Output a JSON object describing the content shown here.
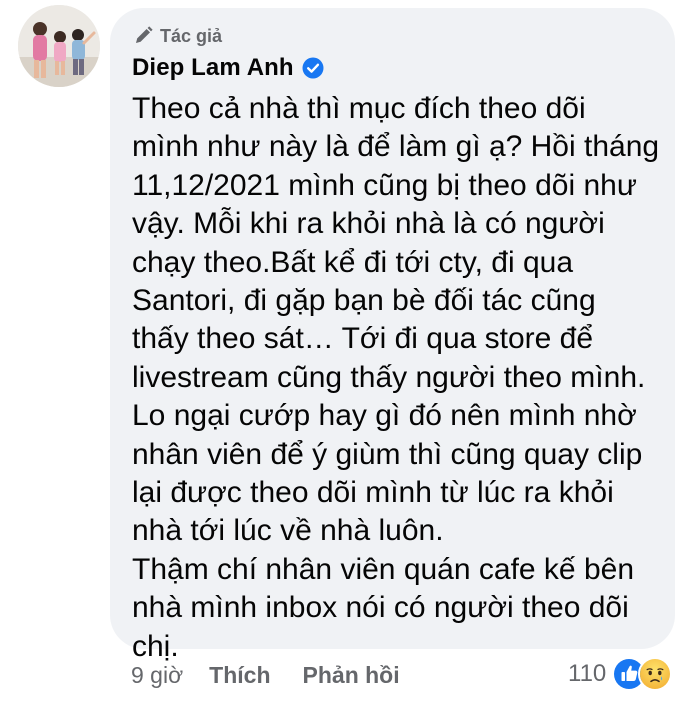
{
  "comment": {
    "author_badge": "Tác giả",
    "author_name": "Diep Lam Anh",
    "lines": [
      "Theo cả nhà thì mục đích theo dõi",
      "mình như này là để làm gì ạ? Hồi tháng",
      "11,12/2021 mình cũng bị theo dõi như",
      "vậy. Mỗi khi ra khỏi nhà là có người",
      "chạy theo.Bất kể đi tới cty, đi qua",
      "Santori, đi gặp bạn bè đối tác cũng",
      "thấy theo sát… Tới đi qua store để",
      "livestream cũng thấy người theo mình.",
      "Lo ngại cướp hay gì đó nên mình nhờ",
      "nhân viên để ý giùm thì cũng quay clip",
      "lại được theo dõi mình từ lúc ra khỏi",
      "nhà tới lúc về nhà luôn.",
      "Thậm chí nhân viên quán cafe kế bên",
      "nhà mình inbox nói có người theo dõi",
      "chị."
    ]
  },
  "actions": {
    "time": "9 giờ",
    "like_label": "Thích",
    "reply_label": "Phản hồi"
  },
  "reactions": {
    "count": "110",
    "icons": [
      "like-reaction-icon",
      "sad-reaction-icon"
    ]
  },
  "colors": {
    "bubble_bg": "#f0f2f5",
    "secondary_text": "#65676b",
    "primary_text": "#050505",
    "verified_blue": "#1877f2"
  }
}
